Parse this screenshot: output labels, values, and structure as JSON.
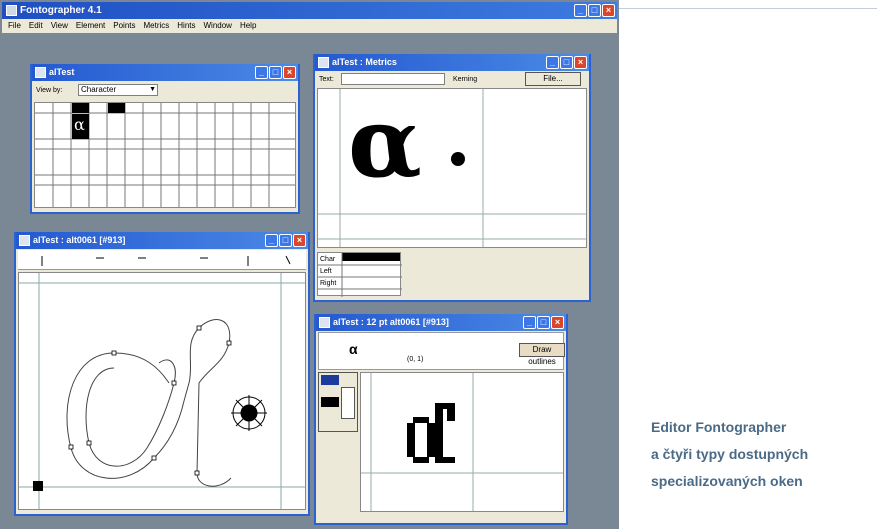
{
  "app": {
    "title": "Fontographer 4.1"
  },
  "menu": [
    "File",
    "Edit",
    "View",
    "Element",
    "Points",
    "Metrics",
    "Hints",
    "Window",
    "Help"
  ],
  "windows": {
    "font": {
      "title": "alTest",
      "view_by_label": "View by:",
      "view_by_value": "Character",
      "glyph": "α"
    },
    "metrics": {
      "title": "alTest : Metrics",
      "text_label": "Text:",
      "kerning": "Kerning",
      "file_button": "File...",
      "glyph": "α",
      "table_labels": [
        "Char",
        "Left",
        "Right"
      ]
    },
    "outline": {
      "title": "alTest : alt0061 [#913]",
      "glyph": "α"
    },
    "bitmap": {
      "title": "alTest : 12 pt alt0061 [#913]",
      "glyph": "α",
      "button": "Draw outlines",
      "coord": "(0, 1)"
    }
  },
  "caption": {
    "line1": "Editor Fontographer",
    "line2": "a čtyři typy dostupných",
    "line3": "specializovaných oken"
  },
  "colors": {
    "desktop": "#7a8895",
    "titlebar": "#2459d0",
    "caption": "#4a6a85"
  }
}
